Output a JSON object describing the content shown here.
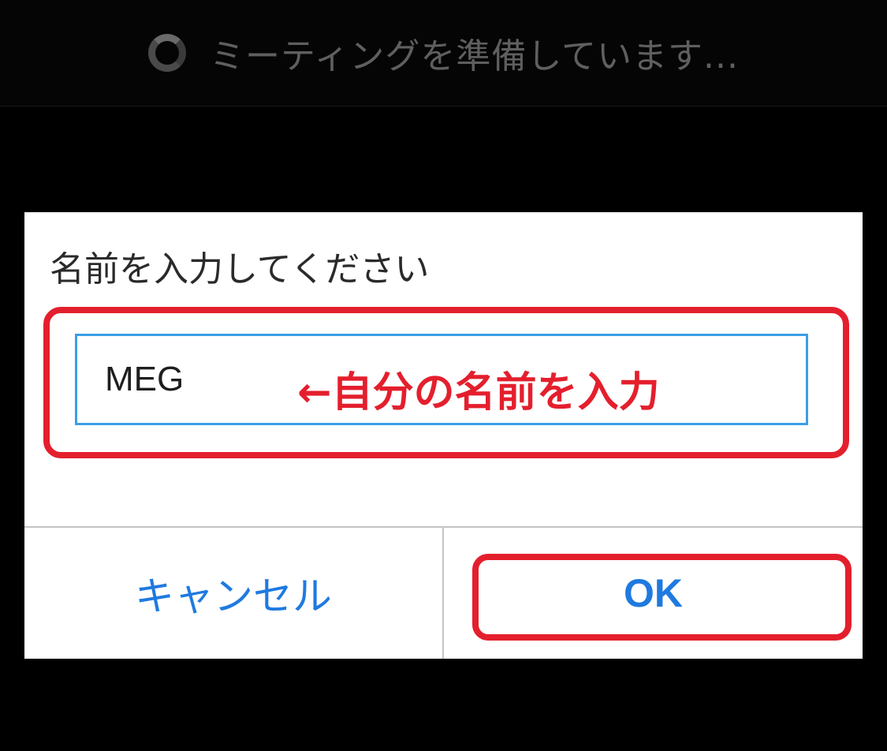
{
  "status": {
    "text": "ミーティングを準備しています..."
  },
  "dialog": {
    "title": "名前を入力してください",
    "name_input": {
      "value": "MEG"
    },
    "annotation": {
      "label": "←自分の名前を入力"
    },
    "buttons": {
      "cancel_label": "キャンセル",
      "ok_label": "OK"
    }
  },
  "colors": {
    "accent_blue": "#1f7ae0",
    "input_border": "#3a9ee8",
    "annotation_red": "#e41f2d",
    "background": "#000000"
  }
}
